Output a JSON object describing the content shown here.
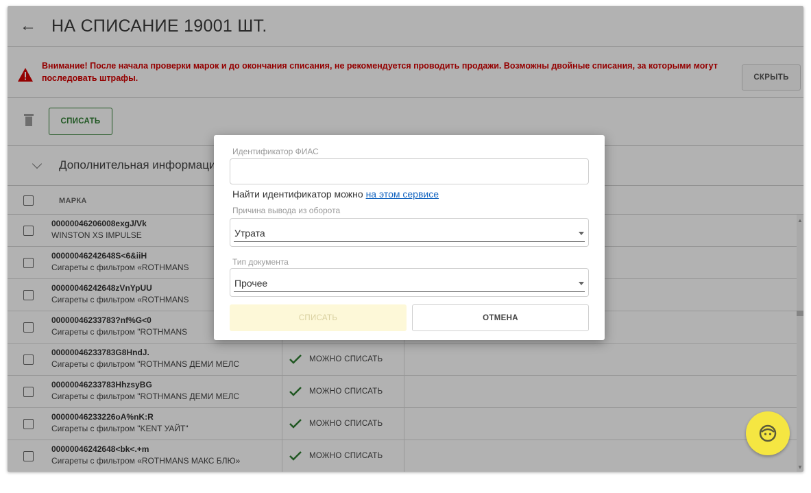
{
  "header": {
    "back_icon": "arrow-left-icon",
    "title": "НА СПИСАНИЕ 19001 ШТ."
  },
  "warning": {
    "icon": "warning-triangle-icon",
    "text": "Внимание! После начала проверки марок и до окончания списания, не рекомендуется проводить продажи. Возможны двойные списания, за которыми могут последовать штрафы.",
    "hide_label": "СКРЫТЬ",
    "color": "#d40000"
  },
  "toolbar": {
    "trash_icon": "trash-icon",
    "writeoff_label": "СПИСАТЬ"
  },
  "extra": {
    "label": "Дополнительная информация"
  },
  "table": {
    "column_mark": "МАРКА",
    "rows": [
      {
        "code": "00000046206008exgJ/Vk",
        "name": "WINSTON XS IMPULSE",
        "status": ""
      },
      {
        "code": "00000046242648S<6&iiH",
        "name": "Сигареты с фильтром «ROTHMANS",
        "status": ""
      },
      {
        "code": "00000046242648zVnYpUU",
        "name": "Сигареты с фильтром «ROTHMANS",
        "status": ""
      },
      {
        "code": "00000046233783?nf%G<0",
        "name": "Сигареты с фильтром \"ROTHMANS",
        "status": ""
      },
      {
        "code": "00000046233783G8HndJ.",
        "name": "Сигареты с фильтром \"ROTHMANS ДЕМИ МЕЛС",
        "status": "МОЖНО СПИСАТЬ"
      },
      {
        "code": "00000046233783HhzsyBG",
        "name": "Сигареты с фильтром \"ROTHMANS ДЕМИ МЕЛС",
        "status": "МОЖНО СПИСАТЬ"
      },
      {
        "code": "00000046233226oA%nK:R",
        "name": "Сигареты с фильтром \"KENT УАЙТ\"",
        "status": "МОЖНО СПИСАТЬ"
      },
      {
        "code": "00000046242648<bk<.+m",
        "name": "Сигареты с фильтром «ROTHMANS МАКС БЛЮ»",
        "status": "МОЖНО СПИСАТЬ"
      }
    ]
  },
  "modal": {
    "fias_label": "Идентификатор ФИАС",
    "fias_value": "",
    "hint_text": "Найти идентификатор можно ",
    "hint_link": "на этом сервисе",
    "reason_label": "Причина вывода из оборота",
    "reason_value": "Утрата",
    "doctype_label": "Тип документа",
    "doctype_value": "Прочее",
    "submit_label": "СПИСАТЬ",
    "cancel_label": "ОТМЕНА"
  },
  "fab": {
    "icon": "chat-support-icon"
  },
  "colors": {
    "accent_green": "#2e7d32",
    "fab_yellow": "#f5e642",
    "link_blue": "#1565c0"
  }
}
